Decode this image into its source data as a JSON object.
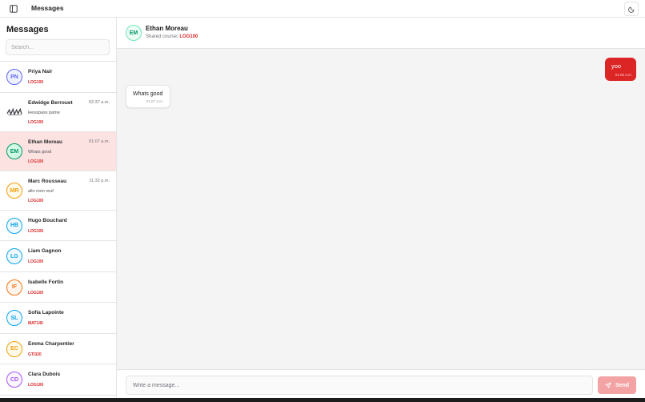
{
  "app": {
    "title": "Messages"
  },
  "colors": {
    "accent": "#dc2626",
    "accent_disabled": "#f3a3a3",
    "active_row": "#fde2e2"
  },
  "sidebar": {
    "heading": "Messages",
    "search_placeholder": "Search...",
    "conversations": [
      {
        "initials": "PN",
        "name": "Priya Nair",
        "time": "",
        "preview": "",
        "course": "LOG100",
        "avatar_color": "#6366f1",
        "avatar_bg": "#eef2ff",
        "active": false,
        "avatar_image": false
      },
      {
        "initials": "",
        "name": "Edwidge Berrouet",
        "time": "02:37 a.m.",
        "preview": "leesspass patne",
        "course": "LOG100",
        "avatar_color": "#3f3f46",
        "avatar_bg": "#ffffff",
        "active": false,
        "avatar_image": true
      },
      {
        "initials": "EM",
        "name": "Ethan Moreau",
        "time": "01:07 a.m.",
        "preview": "Whats good",
        "course": "LOG100",
        "avatar_color": "#059669",
        "avatar_bg": "#d1fae5",
        "active": true,
        "avatar_image": false
      },
      {
        "initials": "MR",
        "name": "Marc Rousseau",
        "time": "11:32 p.m.",
        "preview": "allo mon reuf",
        "course": "LOG100",
        "avatar_color": "#f59e0b",
        "avatar_bg": "#fffbeb",
        "active": false,
        "avatar_image": false
      },
      {
        "initials": "HB",
        "name": "Hugo Bouchard",
        "time": "",
        "preview": "",
        "course": "LOG100",
        "avatar_color": "#0ea5e9",
        "avatar_bg": "#f0f9ff",
        "active": false,
        "avatar_image": false
      },
      {
        "initials": "LG",
        "name": "Liam Gagnon",
        "time": "",
        "preview": "",
        "course": "LOG100",
        "avatar_color": "#0ea5e9",
        "avatar_bg": "#f0f9ff",
        "active": false,
        "avatar_image": false
      },
      {
        "initials": "IF",
        "name": "Isabelle Fortin",
        "time": "",
        "preview": "",
        "course": "LOG100",
        "avatar_color": "#f97316",
        "avatar_bg": "#fff7ed",
        "active": false,
        "avatar_image": false
      },
      {
        "initials": "SL",
        "name": "Sofia Lapointe",
        "time": "",
        "preview": "",
        "course": "MAT145",
        "avatar_color": "#0ea5e9",
        "avatar_bg": "#f0f9ff",
        "active": false,
        "avatar_image": false
      },
      {
        "initials": "EC",
        "name": "Emma Charpentier",
        "time": "",
        "preview": "",
        "course": "GTI320",
        "avatar_color": "#f59e0b",
        "avatar_bg": "#fffbeb",
        "active": false,
        "avatar_image": false
      },
      {
        "initials": "CD",
        "name": "Clara Dubois",
        "time": "",
        "preview": "",
        "course": "LOG100",
        "avatar_color": "#a855f7",
        "avatar_bg": "#faf5ff",
        "active": false,
        "avatar_image": false
      }
    ]
  },
  "chat": {
    "initials": "EM",
    "name": "Ethan Moreau",
    "shared_label": "Shared course:",
    "shared_course": "LOG100",
    "messages": {
      "outgoing": {
        "text": "yoo",
        "time": "01:06 a.m."
      },
      "incoming": {
        "text": "Whats good",
        "time": "01:07 a.m."
      }
    }
  },
  "composer": {
    "placeholder": "Write a message...",
    "send_label": "Send"
  },
  "icons": {
    "sidebar_toggle": "sidebar-toggle-icon",
    "theme": "moon-icon",
    "send": "send-icon"
  }
}
